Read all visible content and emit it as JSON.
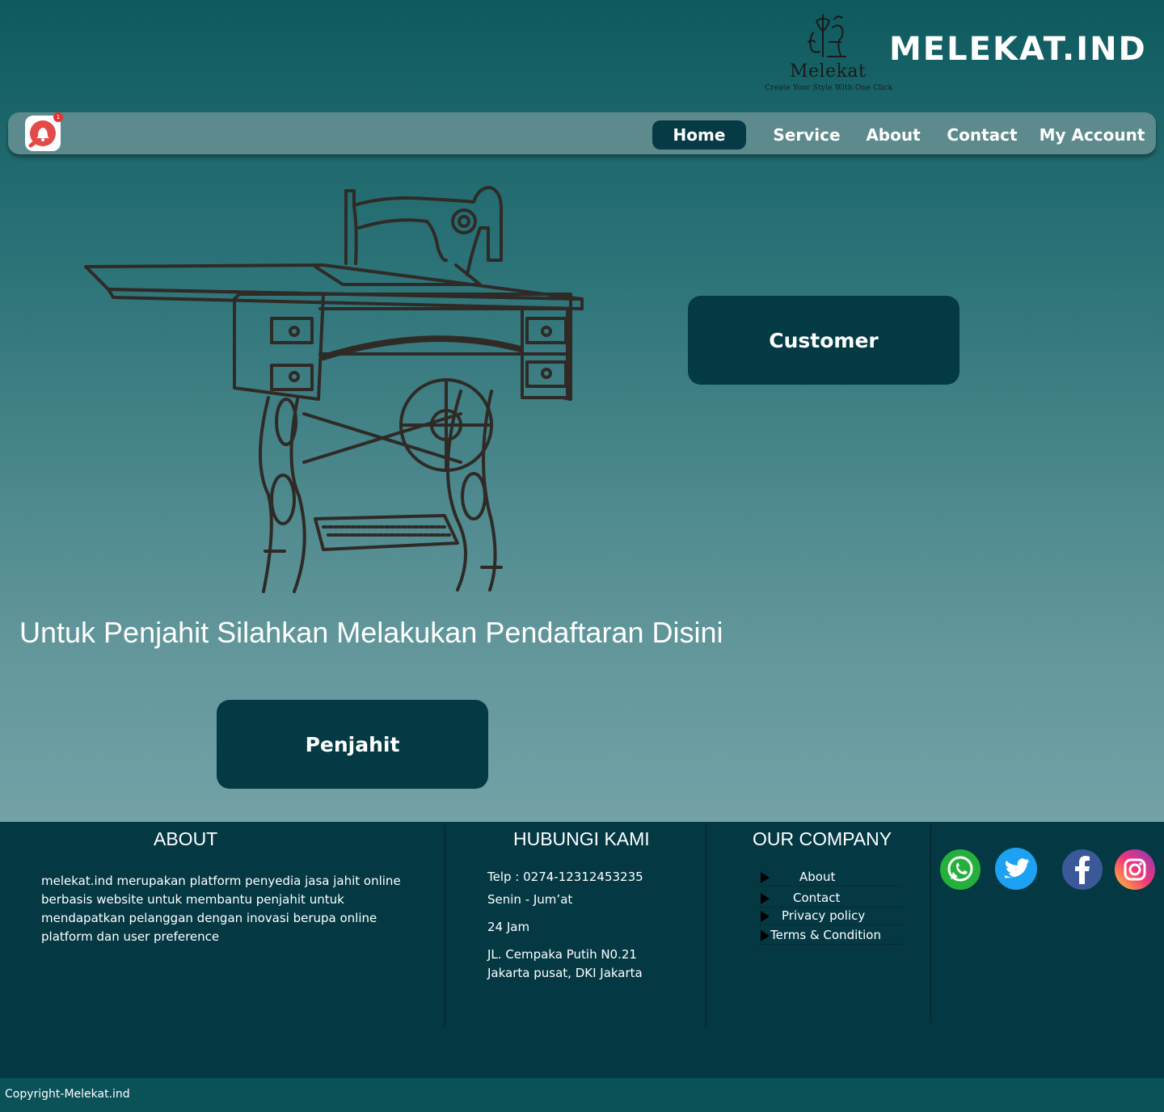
{
  "header": {
    "logo_text": "Melekat",
    "logo_tagline": "Create Your Style With One Click",
    "brand_title": "MELEKAT.IND"
  },
  "notification": {
    "count": "1"
  },
  "nav": {
    "home": "Home",
    "service": "Service",
    "about": "About",
    "contact": "Contact",
    "account": "My Account"
  },
  "hero": {
    "customer_label": "Customer",
    "message": "Untuk Penjahit Silahkan Melakukan Pendaftaran Disini",
    "penjahit_label": "Penjahit"
  },
  "footer": {
    "about": {
      "heading": "ABOUT",
      "body": "melekat.ind merupakan platform penyedia jasa jahit online berbasis website untuk membantu penjahit untuk mendapatkan pelanggan dengan inovasi berupa online platform dan user preference"
    },
    "contact": {
      "heading": "HUBUNGI KAMI",
      "phone": "Telp  :  0274-12312453235",
      "days": "Senin - Jum’at",
      "hours": "24 Jam",
      "address_1": "JL. Cempaka Putih N0.21",
      "address_2": "Jakarta pusat, DKI Jakarta"
    },
    "company": {
      "heading": "OUR COMPANY",
      "links": [
        "About",
        "Contact",
        "Privacy policy",
        "Terms & Condition"
      ]
    },
    "social": [
      "whatsapp-icon",
      "twitter-icon",
      "facebook-icon",
      "instagram-icon"
    ],
    "copyright": "Copyright-Melekat.ind"
  },
  "colors": {
    "nav_bg": "#5d8a8c",
    "accent_dark": "#033a44",
    "footer_bg": "#043944",
    "copyright_bg": "#0a5158"
  }
}
